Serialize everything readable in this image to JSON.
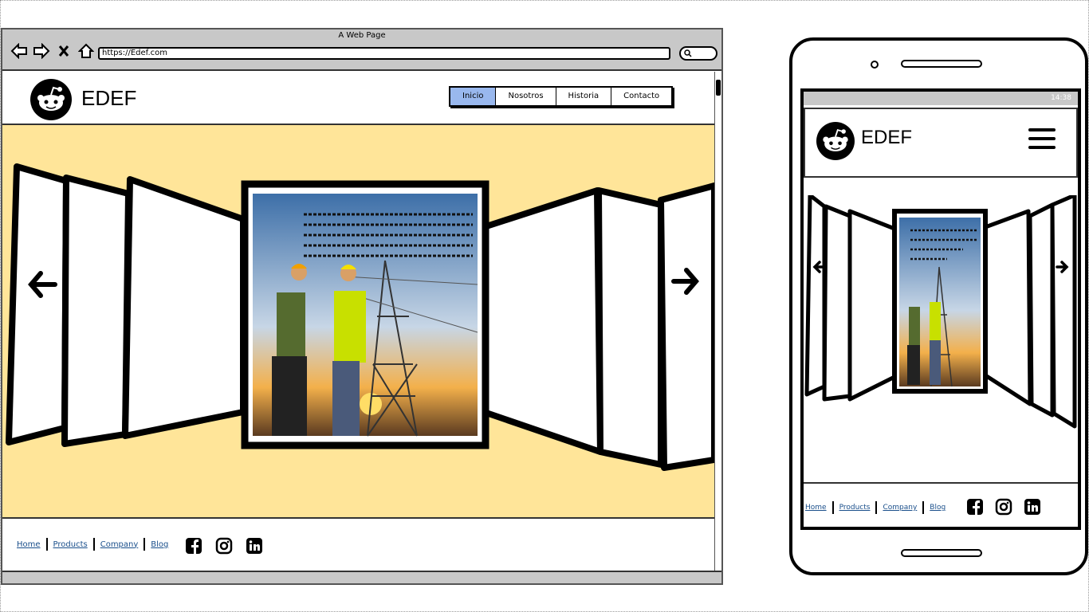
{
  "browser": {
    "window_title": "A Web Page",
    "url": "https://Edef.com"
  },
  "site": {
    "brand": "EDEF",
    "nav": [
      "Inicio",
      "Nosotros",
      "Historia",
      "Contacto"
    ],
    "active_nav": "Inicio",
    "hero_image": "power-line-workers-photo",
    "carousel_prev": "arrow-left-icon",
    "carousel_next": "arrow-right-icon",
    "footer_links": [
      "Home",
      "Products",
      "Company",
      "Blog"
    ],
    "social_icons": [
      "facebook-icon",
      "instagram-icon",
      "linkedin-icon"
    ]
  },
  "phone": {
    "time": "14:38",
    "brand": "EDEF",
    "menu_icon": "hamburger-icon",
    "footer_links": [
      "Home",
      "Products",
      "Company",
      "Blog"
    ]
  },
  "colors": {
    "hero_background": "#ffe599",
    "active_nav": "#99b8ee",
    "link": "#1a4f8b",
    "chrome": "#c8c8c8"
  }
}
